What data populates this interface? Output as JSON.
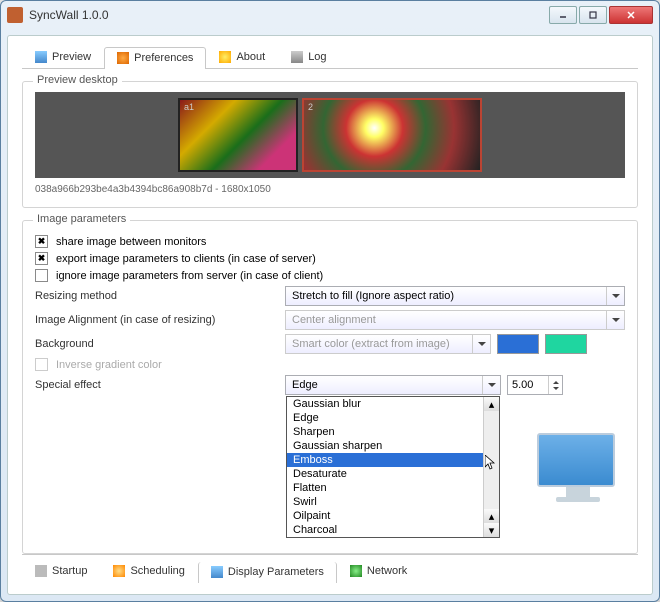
{
  "window": {
    "title": "SyncWall 1.0.0"
  },
  "tabs": {
    "preview": "Preview",
    "preferences": "Preferences",
    "about": "About",
    "log": "Log"
  },
  "preview_group": {
    "label": "Preview  desktop",
    "mon1_label": "a1",
    "mon2_label": "2",
    "caption": "038a966b293be4a3b4394bc86a908b7d - 1680x1050"
  },
  "params_group": {
    "label": "Image parameters",
    "share": "share image between monitors",
    "export": "export image parameters to clients (in case of server)",
    "ignore": "ignore image parameters from server (in case of client)",
    "resizing_label": "Resizing method",
    "resizing_value": "Stretch to fill (Ignore aspect ratio)",
    "alignment_label": "Image Alignment (in case of resizing)",
    "alignment_value": "Center alignment",
    "background_label": "Background",
    "background_value": "Smart color (extract from image)",
    "inverse": "Inverse gradient color",
    "effect_label": "Special effect",
    "effect_value": "Edge",
    "spinner_value": "5.00",
    "effect_options": [
      "Gaussian blur",
      "Edge",
      "Sharpen",
      "Gaussian sharpen",
      "Emboss",
      "Desaturate",
      "Flatten",
      "Swirl",
      "Oilpaint",
      "Charcoal"
    ],
    "effect_selected_index": 4
  },
  "colors": {
    "swatch1": "#2a6fd6",
    "swatch2": "#1fd6a0"
  },
  "bottom_tabs": {
    "startup": "Startup",
    "scheduling": "Scheduling",
    "display": "Display Parameters",
    "network": "Network"
  }
}
